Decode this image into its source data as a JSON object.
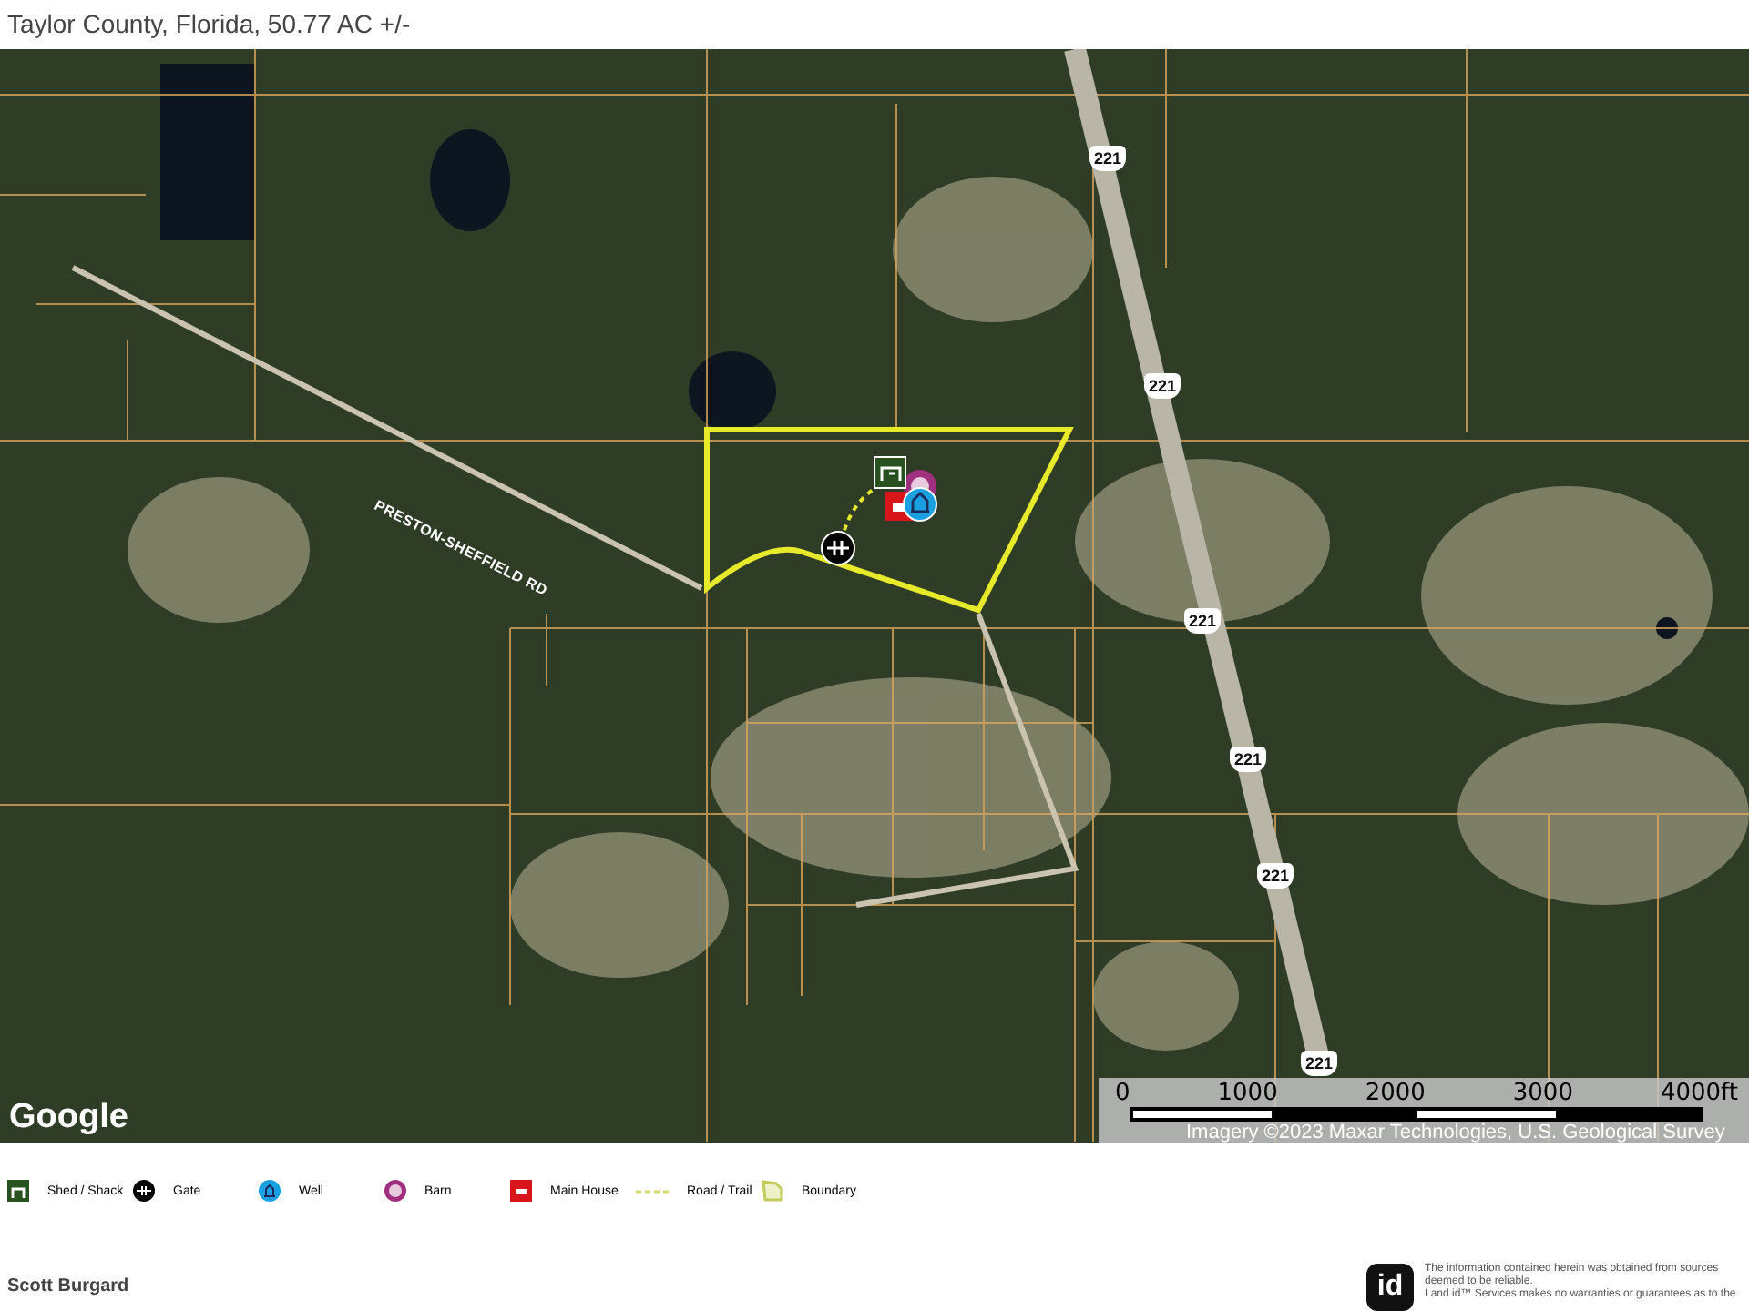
{
  "header": {
    "subtitle": "Taylor County, Florida, 50.77 AC +/-"
  },
  "map": {
    "road_label": "PRESTON-SHEFFIELD RD",
    "highway_shields": [
      "221",
      "221",
      "221",
      "221",
      "221",
      "221"
    ],
    "logo": "Google",
    "scale": {
      "labels": [
        "0",
        "1000",
        "2000",
        "3000",
        "4000ft"
      ]
    },
    "attribution": "Imagery ©2023 Maxar Technologies, U.S. Geological Survey"
  },
  "legend": [
    {
      "kind": "shed",
      "label": "Shed / Shack"
    },
    {
      "kind": "gate",
      "label": "Gate"
    },
    {
      "kind": "well",
      "label": "Well"
    },
    {
      "kind": "barn",
      "label": "Barn"
    },
    {
      "kind": "house",
      "label": "Main House"
    },
    {
      "kind": "trail",
      "label": "Road / Trail"
    },
    {
      "kind": "boundary",
      "label": "Boundary"
    }
  ],
  "footer": {
    "author": "Scott Burgard",
    "logo": "id",
    "disclaimer": [
      "The information contained herein was obtained from sources",
      "deemed to be reliable.",
      "Land id™ Services makes no warranties or guarantees as to the"
    ]
  }
}
